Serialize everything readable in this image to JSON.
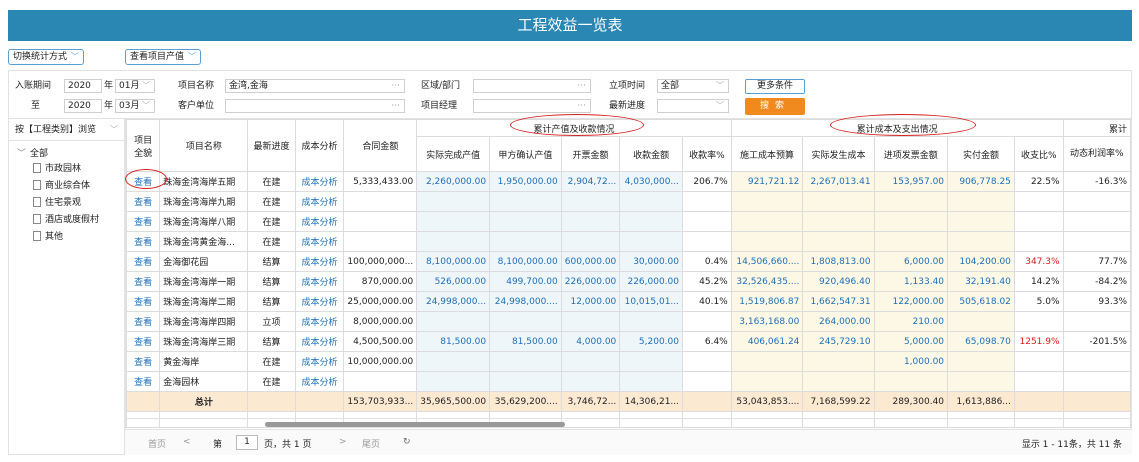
{
  "title": "工程效益一览表",
  "top_buttons": {
    "switch_stat": "切换统计方式",
    "view_value": "查看项目产值"
  },
  "filters": {
    "entry_period_label": "入账期间",
    "from_year": "2020",
    "year_unit": "年",
    "from_month": "01月",
    "to_label": "至",
    "to_year": "2020",
    "to_month": "03月",
    "project_name_label": "项目名称",
    "project_name_value": "金湾,金海",
    "customer_label": "客户单位",
    "customer_value": "",
    "region_label": "区域/部门",
    "region_value": "",
    "manager_label": "项目经理",
    "manager_value": "",
    "setup_time_label": "立项时间",
    "setup_time_value": "全部",
    "progress_label": "最新进度",
    "progress_value": "",
    "more_label": "更多条件",
    "search_label": "搜索",
    "dots": "···"
  },
  "sidebar": {
    "browse_label": "按【工程类别】浏览",
    "root": "全部",
    "items": [
      "市政园林",
      "商业综合体",
      "住宅景观",
      "酒店或度假村",
      "其他"
    ]
  },
  "table": {
    "headers": {
      "full_view": "项目全貌",
      "project_name": "项目名称",
      "progress": "最新进度",
      "cost_analysis": "成本分析",
      "contract_amount": "合同金额",
      "group_output": "累计产值及收款情况",
      "group_cost": "累计成本及支出情况",
      "group_profit": "累计",
      "actual_output": "实际完成产值",
      "confirmed_output": "甲方确认产值",
      "invoice_amount": "开票金额",
      "received_amount": "收款金额",
      "receive_rate": "收款率%",
      "construction_budget": "施工成本预算",
      "actual_cost": "实际发生成本",
      "input_invoice": "进项发票金额",
      "actual_paid": "实付金额",
      "pay_ratio": "收支比%",
      "dynamic_margin": "动态利润率%"
    },
    "rows": [
      {
        "view": "查看",
        "name": "珠海金湾海岸五期",
        "progress": "在建",
        "analysis": "成本分析",
        "contract": "5,333,433.00",
        "actual_output": "2,260,000.00",
        "confirmed": "1,950,000.00",
        "invoice": "2,904,72...",
        "received": "4,030,000...",
        "rate": "206.7%",
        "budget": "921,721.12",
        "actual_cost": "2,267,013.41",
        "input_invoice": "153,957.00",
        "paid": "906,778.25",
        "ratio": "22.5%",
        "margin": "-16.3%"
      },
      {
        "view": "查看",
        "name": "珠海金湾海岸九期",
        "progress": "在建",
        "analysis": "成本分析",
        "contract": "",
        "actual_output": "",
        "confirmed": "",
        "invoice": "",
        "received": "",
        "rate": "",
        "budget": "",
        "actual_cost": "",
        "input_invoice": "",
        "paid": "",
        "ratio": "",
        "margin": ""
      },
      {
        "view": "查看",
        "name": "珠海金湾海岸八期",
        "progress": "在建",
        "analysis": "成本分析",
        "contract": "",
        "actual_output": "",
        "confirmed": "",
        "invoice": "",
        "received": "",
        "rate": "",
        "budget": "",
        "actual_cost": "",
        "input_invoice": "",
        "paid": "",
        "ratio": "",
        "margin": ""
      },
      {
        "view": "查看",
        "name": "珠海金湾黄金海...",
        "progress": "在建",
        "analysis": "成本分析",
        "contract": "",
        "actual_output": "",
        "confirmed": "",
        "invoice": "",
        "received": "",
        "rate": "",
        "budget": "",
        "actual_cost": "",
        "input_invoice": "",
        "paid": "",
        "ratio": "",
        "margin": ""
      },
      {
        "view": "查看",
        "name": "金海御花园",
        "progress": "结算",
        "analysis": "成本分析",
        "contract": "100,000,000...",
        "actual_output": "8,100,000.00",
        "confirmed": "8,100,000.00",
        "invoice": "600,000.00",
        "received": "30,000.00",
        "rate": "0.4%",
        "budget": "14,506,660....",
        "actual_cost": "1,808,813.00",
        "input_invoice": "6,000.00",
        "paid": "104,200.00",
        "ratio": "347.3%",
        "margin": "77.7%"
      },
      {
        "view": "查看",
        "name": "珠海金湾海岸一期",
        "progress": "结算",
        "analysis": "成本分析",
        "contract": "870,000.00",
        "actual_output": "526,000.00",
        "confirmed": "499,700.00",
        "invoice": "226,000.00",
        "received": "226,000.00",
        "rate": "45.2%",
        "budget": "32,526,435....",
        "actual_cost": "920,496.40",
        "input_invoice": "1,133.40",
        "paid": "32,191.40",
        "ratio": "14.2%",
        "margin": "-84.2%"
      },
      {
        "view": "查看",
        "name": "珠海金湾海岸二期",
        "progress": "结算",
        "analysis": "成本分析",
        "contract": "25,000,000.00",
        "actual_output": "24,998,000...",
        "confirmed": "24,998,000....",
        "invoice": "12,000.00",
        "received": "10,015,01...",
        "rate": "40.1%",
        "budget": "1,519,806.87",
        "actual_cost": "1,662,547.31",
        "input_invoice": "122,000.00",
        "paid": "505,618.02",
        "ratio": "5.0%",
        "margin": "93.3%"
      },
      {
        "view": "查看",
        "name": "珠海金湾海岸四期",
        "progress": "立项",
        "analysis": "成本分析",
        "contract": "8,000,000.00",
        "actual_output": "",
        "confirmed": "",
        "invoice": "",
        "received": "",
        "rate": "",
        "budget": "3,163,168.00",
        "actual_cost": "264,000.00",
        "input_invoice": "210.00",
        "paid": "",
        "ratio": "",
        "margin": ""
      },
      {
        "view": "查看",
        "name": "珠海金湾海岸三期",
        "progress": "结算",
        "analysis": "成本分析",
        "contract": "4,500,500.00",
        "actual_output": "81,500.00",
        "confirmed": "81,500.00",
        "invoice": "4,000.00",
        "received": "5,200.00",
        "rate": "6.4%",
        "budget": "406,061.24",
        "actual_cost": "245,729.10",
        "input_invoice": "5,000.00",
        "paid": "65,098.70",
        "ratio": "1251.9%",
        "margin": "-201.5%"
      },
      {
        "view": "查看",
        "name": "黄金海岸",
        "progress": "在建",
        "analysis": "成本分析",
        "contract": "10,000,000.00",
        "actual_output": "",
        "confirmed": "",
        "invoice": "",
        "received": "",
        "rate": "",
        "budget": "",
        "actual_cost": "",
        "input_invoice": "1,000.00",
        "paid": "",
        "ratio": "",
        "margin": ""
      },
      {
        "view": "查看",
        "name": "金海园林",
        "progress": "在建",
        "analysis": "成本分析",
        "contract": "",
        "actual_output": "",
        "confirmed": "",
        "invoice": "",
        "received": "",
        "rate": "",
        "budget": "",
        "actual_cost": "",
        "input_invoice": "",
        "paid": "",
        "ratio": "",
        "margin": ""
      }
    ],
    "total": {
      "label": "总计",
      "contract": "153,703,933...",
      "actual_output": "35,965,500.00",
      "confirmed": "35,629,200....",
      "invoice": "3,746,72...",
      "received": "14,306,21...",
      "budget": "53,043,853....",
      "actual_cost": "7,168,599.22",
      "input_invoice": "289,300.40",
      "paid": "1,613,886..."
    }
  },
  "pager": {
    "first": "首页",
    "prev": "<",
    "page_prefix": "第",
    "page": "1",
    "page_suffix": "页，共 1 页",
    "next": ">",
    "last": "尾页",
    "refresh": "↻",
    "summary": "显示 1 - 11条，共 11 条"
  },
  "colors": {
    "title_bar": "#2a86b3",
    "link": "#1e6fb8",
    "negative_highlight": "#d61d1d",
    "search_button": "#f08a1f",
    "total_row": "#fbe9d2",
    "annotation": "#d62020"
  }
}
